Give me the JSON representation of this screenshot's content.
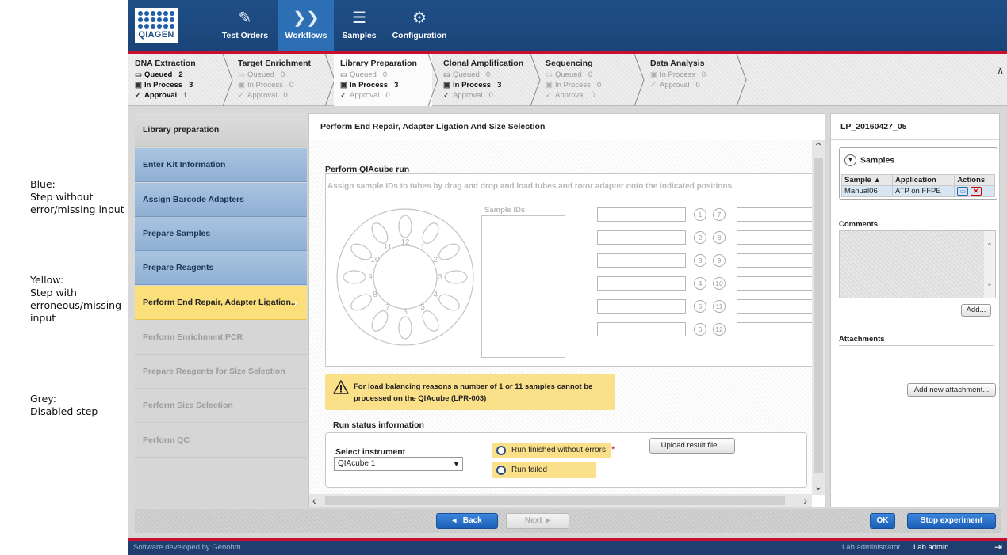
{
  "annotations": [
    {
      "text": "Blue:\nStep without\nerror/missing input"
    },
    {
      "text": "Yellow:\nStep with\nerroneous/missing\ninput"
    },
    {
      "text": "Grey:\nDisabled step"
    }
  ],
  "logo_text": "QIAGEN",
  "nav": [
    {
      "label": "Test Orders",
      "icon": "pencil-icon"
    },
    {
      "label": "Workflows",
      "icon": "chevrons-icon",
      "active": true
    },
    {
      "label": "Samples",
      "icon": "list-icon"
    },
    {
      "label": "Configuration",
      "icon": "gears-icon"
    }
  ],
  "stages": [
    {
      "name": "DNA Extraction",
      "rows": [
        {
          "label": "Queued",
          "count": "2"
        },
        {
          "label": "In Process",
          "count": "3"
        },
        {
          "label": "Approval",
          "count": "1"
        }
      ]
    },
    {
      "name": "Target Enrichment",
      "rows": [
        {
          "label": "Queued",
          "count": "0"
        },
        {
          "label": "In Process",
          "count": "0"
        },
        {
          "label": "Approval",
          "count": "0"
        }
      ]
    },
    {
      "name": "Library Preparation",
      "rows": [
        {
          "label": "Queued",
          "count": "0"
        },
        {
          "label": "In Process",
          "count": "3"
        },
        {
          "label": "Approval",
          "count": "0"
        }
      ]
    },
    {
      "name": "Clonal Amplification",
      "rows": [
        {
          "label": "Queued",
          "count": "0"
        },
        {
          "label": "In Process",
          "count": "3"
        },
        {
          "label": "Approval",
          "count": "0"
        }
      ]
    },
    {
      "name": "Sequencing",
      "rows": [
        {
          "label": "Queued",
          "count": "0"
        },
        {
          "label": "In Process",
          "count": "0"
        },
        {
          "label": "Approval",
          "count": "0"
        }
      ]
    },
    {
      "name": "Data Analysis",
      "rows": [
        {
          "label": "In Process",
          "count": "0"
        },
        {
          "label": "Approval",
          "count": "0"
        }
      ]
    }
  ],
  "steps": {
    "header": "Library preparation",
    "items": [
      {
        "label": "Enter Kit Information",
        "state": "blue"
      },
      {
        "label": "Assign Barcode Adapters",
        "state": "blue"
      },
      {
        "label": "Prepare Samples",
        "state": "blue"
      },
      {
        "label": "Prepare Reagents",
        "state": "blue"
      },
      {
        "label": "Perform End Repair, Adapter Ligation...",
        "state": "yellow"
      },
      {
        "label": "Perform Enrichment PCR",
        "state": "grey"
      },
      {
        "label": "Prepare Reagents for Size Selection",
        "state": "grey"
      },
      {
        "label": "Perform Size Selection",
        "state": "grey"
      },
      {
        "label": "Perform QC",
        "state": "grey"
      }
    ]
  },
  "main": {
    "title": "Perform End Repair, Adapter Ligation And Size Selection",
    "qiacube_title": "Perform QIAcube run",
    "qiacube_instruction": "Assign sample IDs to tubes by drag and drop and load tubes and rotor adapter onto the indicated positions.",
    "sample_ids_label": "Sample IDs",
    "rotor_numbers": [
      "1",
      "2",
      "3",
      "4",
      "5",
      "6",
      "7",
      "8",
      "9",
      "10",
      "11",
      "12"
    ],
    "position_numbers": [
      "1",
      "7",
      "2",
      "8",
      "3",
      "9",
      "4",
      "10",
      "5",
      "11",
      "6",
      "12"
    ],
    "warning": "For load balancing reasons a number of 1 or 11 samples cannot be processed on the QIAcube (LPR-003)",
    "run_status_title": "Run status information",
    "select_instrument_label": "Select instrument",
    "instrument_value": "QIAcube 1",
    "radio_ok": "Run finished without errors",
    "radio_fail": "Run failed",
    "required_mark": "*",
    "upload_label": "Upload result file..."
  },
  "right": {
    "experiment_id": "LP_20160427_05",
    "samples_title": "Samples",
    "columns": [
      "Sample",
      "Application",
      "Actions"
    ],
    "rows": [
      {
        "sample": "Manual06",
        "application": "ATP on FFPE"
      }
    ],
    "comments_label": "Comments",
    "add_label": "Add...",
    "attachments_label": "Attachments",
    "add_attachment_label": "Add new attachment..."
  },
  "bottom": {
    "back": "Back",
    "next": "Next",
    "ok": "OK",
    "stop": "Stop experiment"
  },
  "footer": {
    "developer": "Software developed by Genohm",
    "role": "Lab administrator",
    "user": "Lab admin"
  },
  "colors": {
    "brand_blue": "#1f4f86",
    "accent_red": "#c8102e",
    "step_blue": "#9fbcdc",
    "step_yellow": "#fbdf7a",
    "step_grey": "#d6d6d6"
  }
}
